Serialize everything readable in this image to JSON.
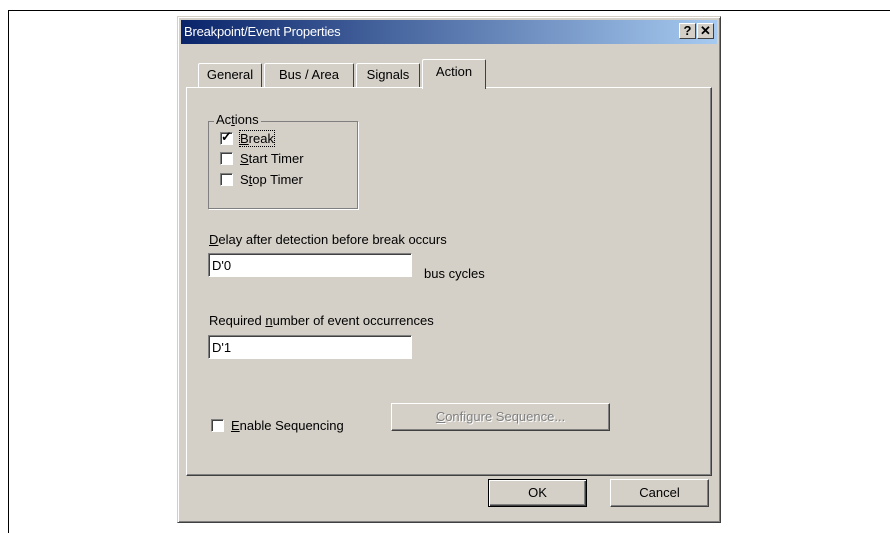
{
  "window": {
    "title": "Breakpoint/Event Properties",
    "help_glyph": "?",
    "close_glyph": "✕"
  },
  "tabs": [
    {
      "label": "General"
    },
    {
      "label": "Bus / Area"
    },
    {
      "label": "Signals"
    },
    {
      "label": "Action"
    }
  ],
  "active_tab": "Action",
  "actions_group": {
    "title_pre": "Ac",
    "title_ul": "t",
    "title_post": "ions",
    "items": [
      {
        "ul": "B",
        "rest": "reak",
        "checked": true,
        "check_glyph": "✓"
      },
      {
        "ul": "S",
        "rest": "tart Timer",
        "checked": false
      },
      {
        "pre": "S",
        "ul": "t",
        "rest": "op Timer",
        "checked": false
      }
    ]
  },
  "delay": {
    "label_ul": "D",
    "label_rest": "elay after detection before break occurs",
    "value": "D'0",
    "unit": "bus cycles"
  },
  "occurrences": {
    "label_pre": "Required ",
    "label_ul": "n",
    "label_rest": "umber of event occurrences",
    "value": "D'1"
  },
  "sequencing": {
    "checkbox_ul": "E",
    "checkbox_rest": "nable Sequencing",
    "checked": false,
    "configure_ul": "C",
    "configure_rest": "onfigure Sequence...",
    "configure_enabled": false
  },
  "footer": {
    "ok_label": "OK",
    "cancel_label": "Cancel"
  }
}
